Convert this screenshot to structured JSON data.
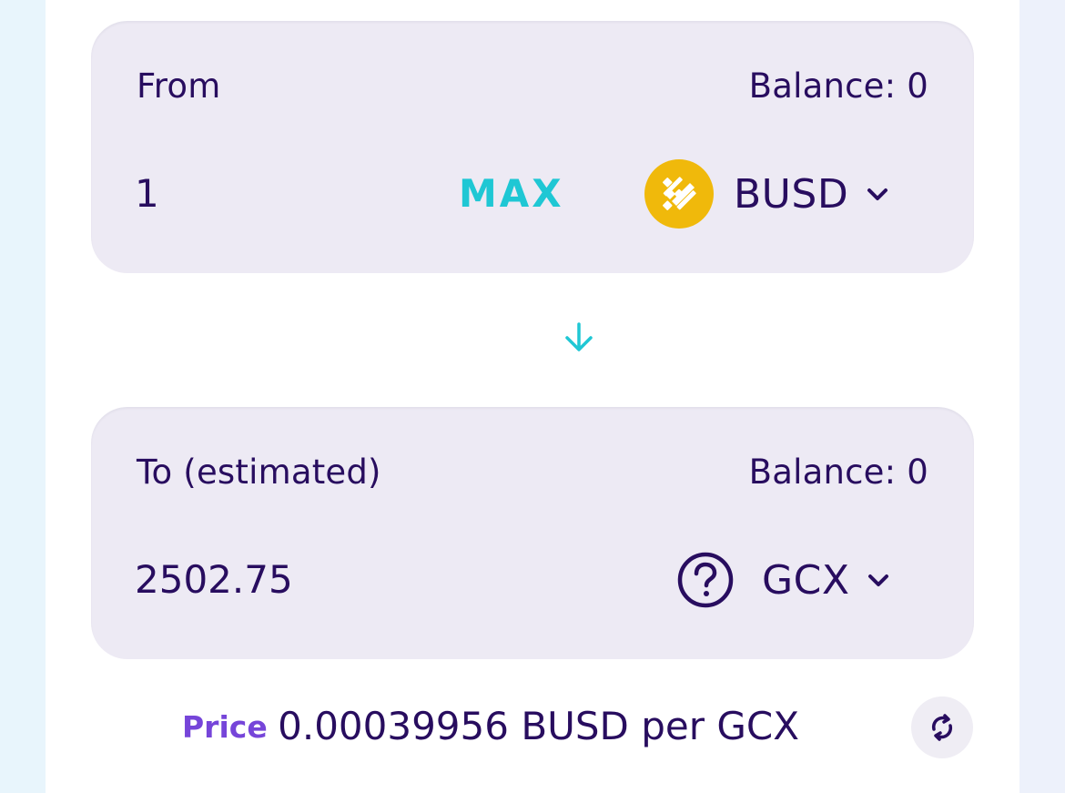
{
  "from": {
    "label": "From",
    "balance": "Balance: 0",
    "amount": "1",
    "max_label": "MAX",
    "token": {
      "symbol": "BUSD",
      "icon": "busd-logo-icon",
      "color": "#f0b90b"
    }
  },
  "swap_arrow": {
    "icon": "arrow-down-icon",
    "color": "#1fc7d4"
  },
  "to": {
    "label": "To (estimated)",
    "balance": "Balance: 0",
    "amount": "2502.75",
    "token": {
      "symbol": "GCX",
      "icon": "question-circle-icon"
    }
  },
  "price": {
    "label": "Price",
    "value": "0.00039956 BUSD per GCX",
    "refresh_icon": "refresh-icon"
  },
  "colors": {
    "text": "#280d5f",
    "accent": "#1fc7d4",
    "secondary": "#7645d9",
    "panel": "#edeaf4"
  }
}
